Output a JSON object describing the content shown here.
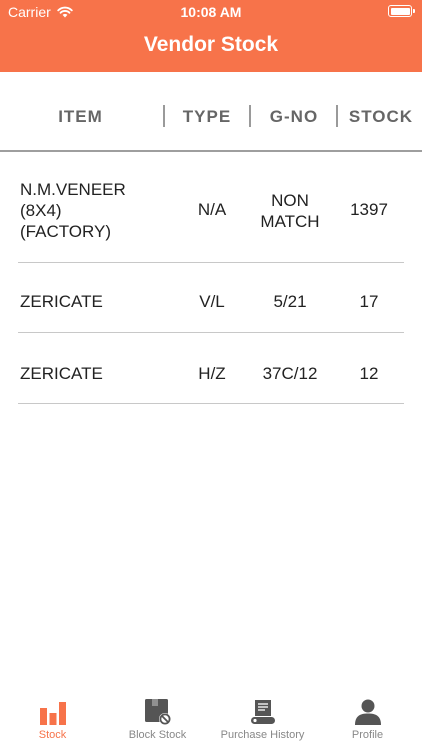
{
  "status_bar": {
    "carrier": "Carrier",
    "time": "10:08 AM"
  },
  "header": {
    "title": "Vendor Stock"
  },
  "table": {
    "columns": [
      "ITEM",
      "TYPE",
      "G-NO",
      "STOCK"
    ],
    "rows": [
      {
        "item": [
          "N.M.VENEER",
          "(8X4)",
          "(FACTORY)"
        ],
        "type": "N/A",
        "gno": [
          "NON",
          "MATCH"
        ],
        "stock": "1397"
      },
      {
        "item": [
          "ZERICATE"
        ],
        "type": "V/L",
        "gno": [
          "5/21"
        ],
        "stock": "17"
      },
      {
        "item": [
          "ZERICATE"
        ],
        "type": "H/Z",
        "gno": [
          "37C/12"
        ],
        "stock": "12"
      }
    ]
  },
  "tabs": [
    {
      "label": "Stock",
      "icon": "bar-chart-icon",
      "active": true
    },
    {
      "label": "Block Stock",
      "icon": "box-blocked-icon",
      "active": false
    },
    {
      "label": "Purchase History",
      "icon": "receipt-icon",
      "active": false
    },
    {
      "label": "Profile",
      "icon": "person-icon",
      "active": false
    }
  ],
  "colors": {
    "accent": "#F7734A",
    "tab_inactive": "#555555"
  }
}
